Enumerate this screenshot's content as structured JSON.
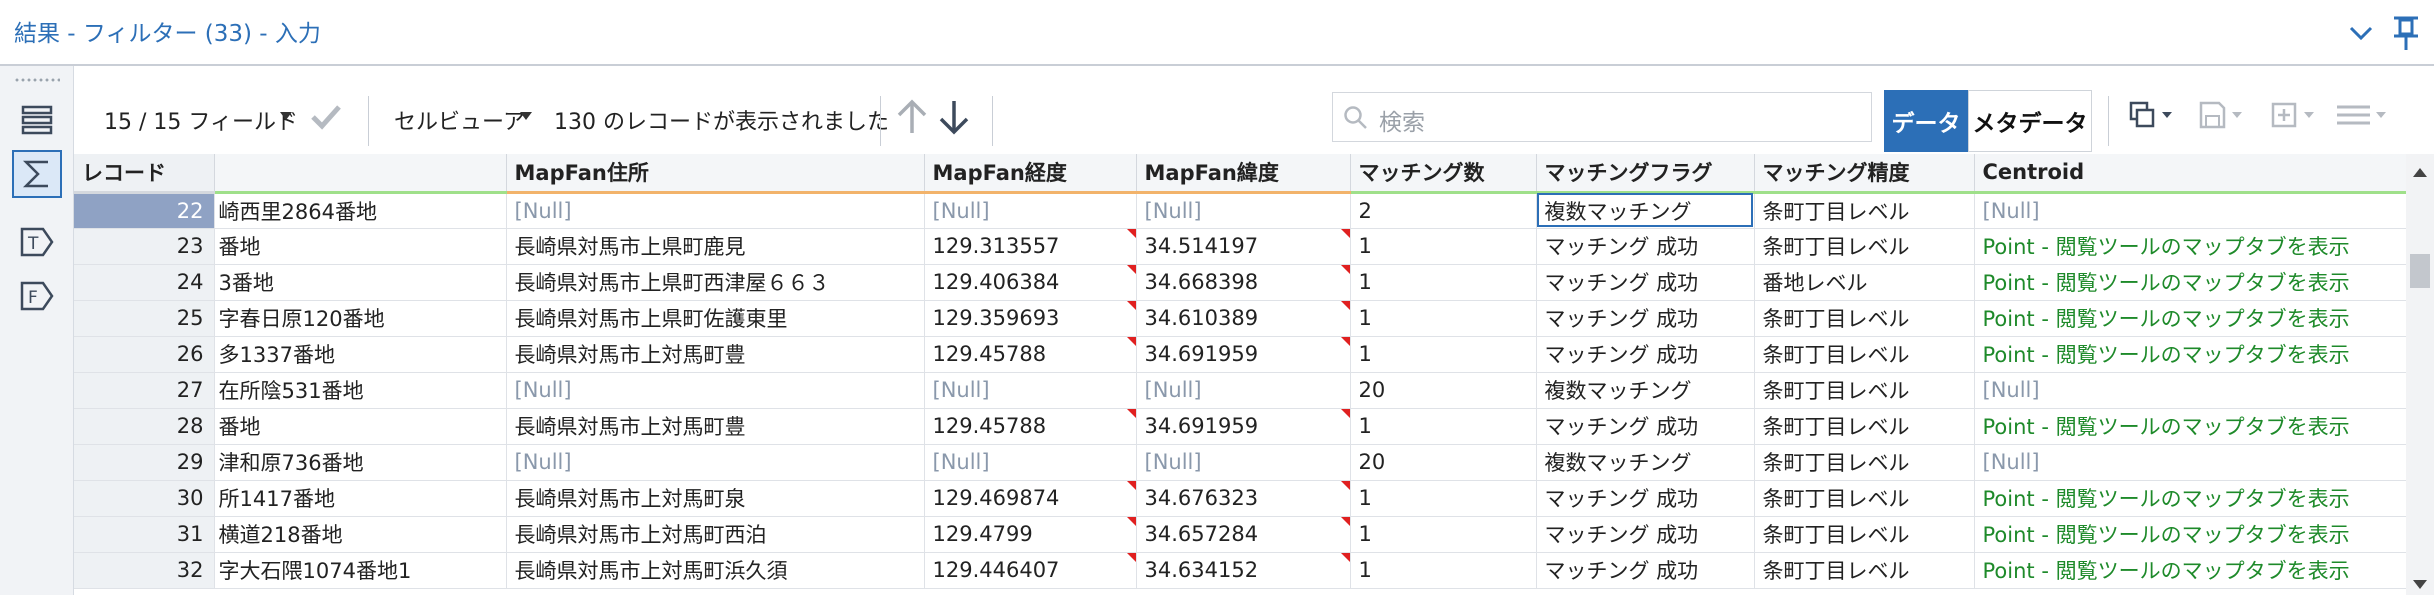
{
  "window": {
    "title": "結果 - フィルター (33) - 入力"
  },
  "toolbar": {
    "field_count": "15 / 15 フィールド",
    "cell_viewer": "セルビューア",
    "record_status": "130 のレコードが表示されました",
    "search_placeholder": "検索",
    "tab_data": "データ",
    "tab_metadata": "メタデータ"
  },
  "table": {
    "columns": [
      "レコード",
      "",
      "MapFan住所",
      "MapFan経度",
      "MapFan緯度",
      "マッチング数",
      "マッチングフラグ",
      "マッチング精度",
      "Centroid"
    ],
    "rows": [
      [
        "22",
        "崎西里2864番地",
        "[Null]",
        "[Null]",
        "[Null]",
        "2",
        "複数マッチング",
        "条町丁目レベル",
        "[Null]"
      ],
      [
        "23",
        "番地",
        "長崎県対馬市上県町鹿見",
        "129.313557",
        "34.514197",
        "1",
        "マッチング 成功",
        "条町丁目レベル",
        "Point - 閲覧ツールのマップタブを表示"
      ],
      [
        "24",
        "3番地",
        "長崎県対馬市上県町西津屋６６３",
        "129.406384",
        "34.668398",
        "1",
        "マッチング 成功",
        "番地レベル",
        "Point - 閲覧ツールのマップタブを表示"
      ],
      [
        "25",
        "字春日原120番地",
        "長崎県対馬市上県町佐護東里",
        "129.359693",
        "34.610389",
        "1",
        "マッチング 成功",
        "条町丁目レベル",
        "Point - 閲覧ツールのマップタブを表示"
      ],
      [
        "26",
        "多1337番地",
        "長崎県対馬市上対馬町豊",
        "129.45788",
        "34.691959",
        "1",
        "マッチング 成功",
        "条町丁目レベル",
        "Point - 閲覧ツールのマップタブを表示"
      ],
      [
        "27",
        "在所陰531番地",
        "[Null]",
        "[Null]",
        "[Null]",
        "20",
        "複数マッチング",
        "条町丁目レベル",
        "[Null]"
      ],
      [
        "28",
        "番地",
        "長崎県対馬市上対馬町豊",
        "129.45788",
        "34.691959",
        "1",
        "マッチング 成功",
        "条町丁目レベル",
        "Point - 閲覧ツールのマップタブを表示"
      ],
      [
        "29",
        "津和原736番地",
        "[Null]",
        "[Null]",
        "[Null]",
        "20",
        "複数マッチング",
        "条町丁目レベル",
        "[Null]"
      ],
      [
        "30",
        "所1417番地",
        "長崎県対馬市上対馬町泉",
        "129.469874",
        "34.676323",
        "1",
        "マッチング 成功",
        "条町丁目レベル",
        "Point - 閲覧ツールのマップタブを表示"
      ],
      [
        "31",
        "横道218番地",
        "長崎県対馬市上対馬町西泊",
        "129.4799",
        "34.657284",
        "1",
        "マッチング 成功",
        "条町丁目レベル",
        "Point - 閲覧ツールのマップタブを表示"
      ],
      [
        "32",
        "字大石隈1074番地1",
        "長崎県対馬市上対馬町浜久須",
        "129.446407",
        "34.634152",
        "1",
        "マッチング 成功",
        "条町丁目レベル",
        "Point - 閲覧ツールのマップタブを表示"
      ]
    ]
  },
  "colors": {
    "accent": "#2c6fb7",
    "null_text": "#8a98ab",
    "point_text": "#1e8a2a",
    "flag": "#e02020"
  }
}
